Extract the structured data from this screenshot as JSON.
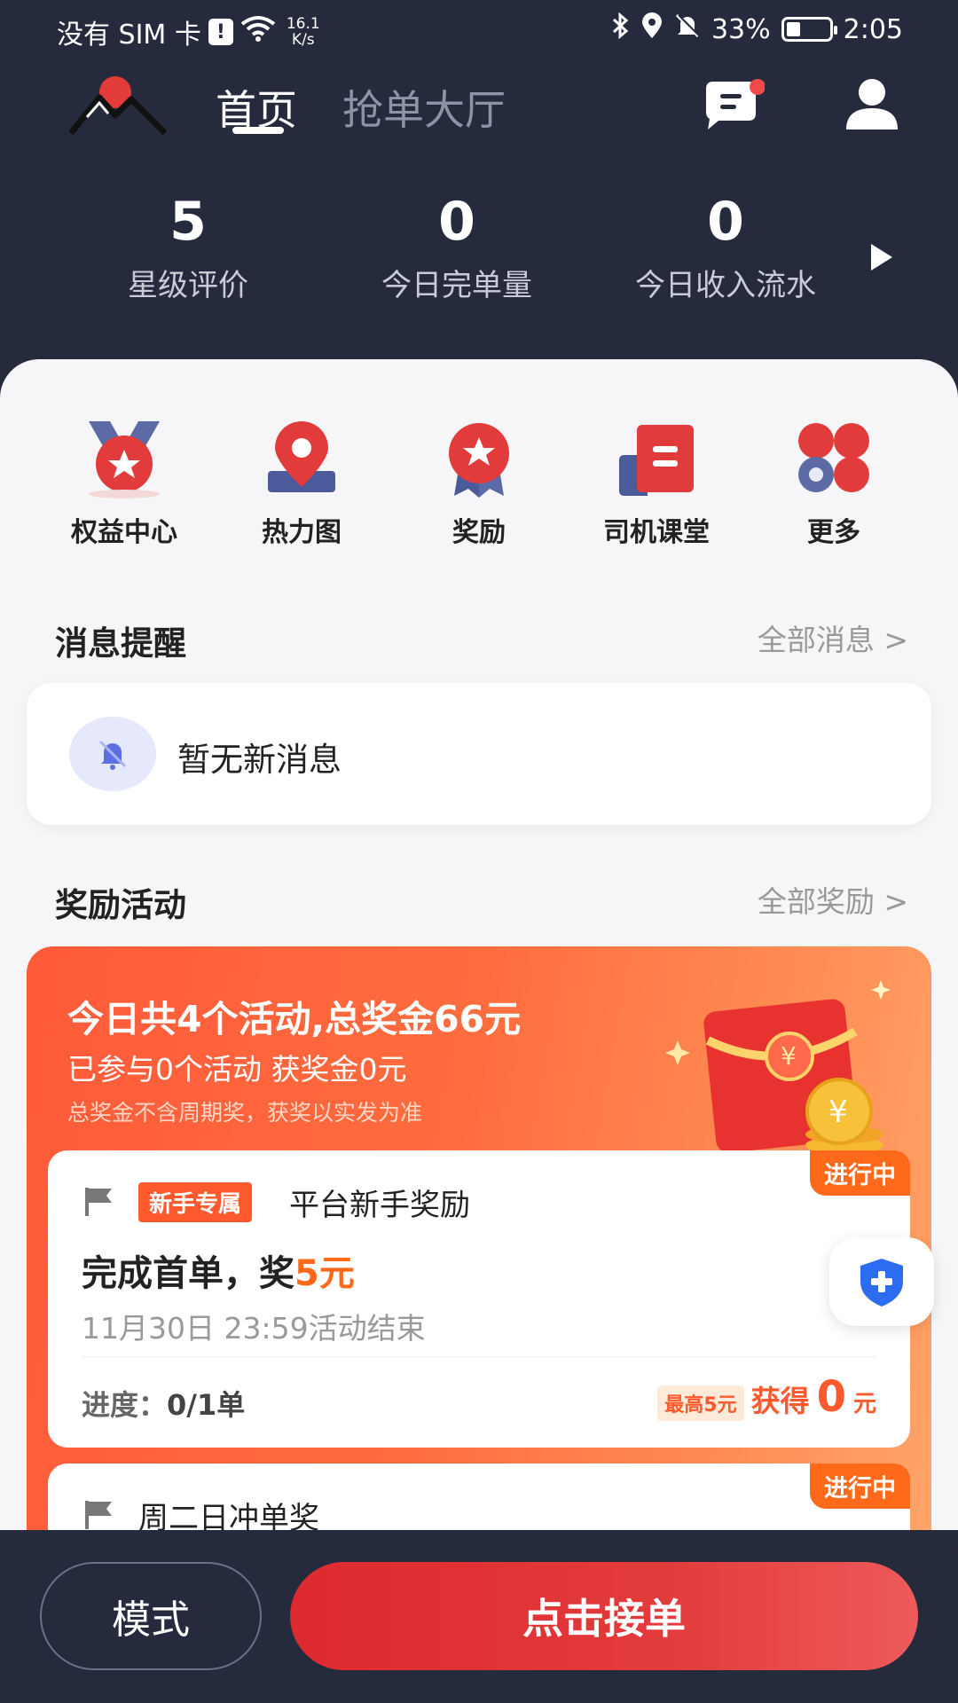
{
  "status_bar": {
    "carrier": "没有 SIM 卡",
    "sim_alert": "!",
    "net_speed_value": "16.1",
    "net_speed_unit": "K/s",
    "battery_percent": "33%",
    "battery_level": 0.33,
    "time": "2:05"
  },
  "header": {
    "tabs": [
      {
        "label": "首页",
        "active": true
      },
      {
        "label": "抢单大厅",
        "active": false
      }
    ],
    "message_has_badge": true
  },
  "stats": [
    {
      "value": "5",
      "label": "星级评价"
    },
    {
      "value": "0",
      "label": "今日完单量"
    },
    {
      "value": "0",
      "label": "今日收入流水"
    }
  ],
  "quick_actions": [
    {
      "label": "权益中心",
      "icon": "medal-icon"
    },
    {
      "label": "热力图",
      "icon": "map-pin-icon"
    },
    {
      "label": "奖励",
      "icon": "award-icon"
    },
    {
      "label": "司机课堂",
      "icon": "book-icon"
    },
    {
      "label": "更多",
      "icon": "more-icon"
    }
  ],
  "messages": {
    "title": "消息提醒",
    "more": "全部消息 >",
    "empty_text": "暂无新消息"
  },
  "rewards": {
    "title": "奖励活动",
    "more": "全部奖励 >",
    "banner": {
      "headline": "今日共4个活动,总奖金66元",
      "participated": "已参与0个活动 获奖金0元",
      "note": "总奖金不含周期奖，获奖以实发为准"
    },
    "activities": [
      {
        "status": "进行中",
        "tag": "新手专属",
        "name": "平台新手奖励",
        "goal_prefix": "完成首单，奖",
        "goal_amount": "5元",
        "end_time": "11月30日 23:59活动结束",
        "progress_label": "进度：",
        "progress_value": "0/1单",
        "max_tag": "最高5元",
        "earned_label": "获得",
        "earned_value": "0",
        "earned_unit": "元"
      },
      {
        "status": "进行中",
        "name": "周二日冲单奖"
      }
    ]
  },
  "bottom": {
    "mode_label": "模式",
    "accept_label": "点击接单"
  },
  "colors": {
    "header_bg": "#262a3d",
    "accent_orange": "#ff6a1a",
    "accept_red": "#e0302f",
    "shield_blue": "#2b6cf0"
  }
}
